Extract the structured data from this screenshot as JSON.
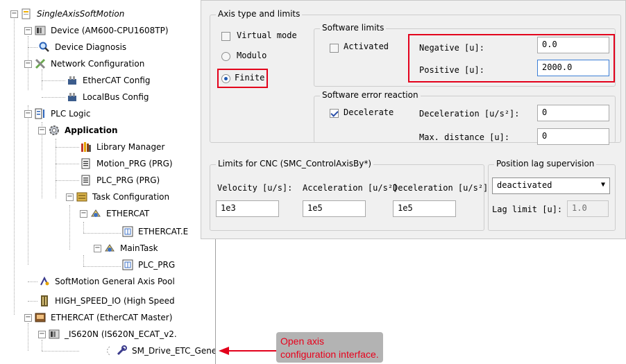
{
  "tree": {
    "root": "SingleAxisSoftMotion",
    "device": "Device (AM600-CPU1608TP)",
    "device_diagnosis": "Device Diagnosis",
    "network_configuration": "Network Configuration",
    "ethercat_config": "EtherCAT Config",
    "localbus_config": "LocalBus Config",
    "plc_logic": "PLC Logic",
    "application": "Application",
    "library_manager": "Library Manager",
    "motion_prg": "Motion_PRG (PRG)",
    "plc_prg": "PLC_PRG (PRG)",
    "task_configuration": "Task Configuration",
    "ethercat_task": "ETHERCAT",
    "ethercat_e": "ETHERCAT.E",
    "main_task": "MainTask",
    "plc_prg_call": "PLC_PRG",
    "softmotion_pool": "SoftMotion General Axis Pool",
    "high_speed_io": "HIGH_SPEED_IO (High Speed",
    "ethercat_master": "ETHERCAT (EtherCAT Master)",
    "is620n": "_IS620N (IS620N_ECAT_v2.",
    "sm_drive": "SM_Drive_ETC_Generi"
  },
  "panel": {
    "axis_group_title": "Axis type and limits",
    "virtual_mode": "Virtual mode",
    "modulo": "Modulo",
    "finite": "Finite",
    "sw_limits_title": "Software limits",
    "activated": "Activated",
    "negative_label": "Negative [u]:",
    "negative_value": "0.0",
    "positive_label": "Positive [u]:",
    "positive_value": "2000.0",
    "sw_error_title": "Software error reaction",
    "decelerate": "Decelerate",
    "deceleration_label": "Deceleration [u/s²]:",
    "deceleration_value": "0",
    "max_distance_label": "Max. distance [u]:",
    "max_distance_value": "0",
    "cnc_title": "Limits for CNC (SMC_ControlAxisBy*)",
    "velocity_label": "Velocity [u/s]:",
    "velocity_value": "1e3",
    "acceleration_label": "Acceleration [u/s²]",
    "acceleration_value": "1e5",
    "cnc_deceleration_label": "Deceleration [u/s²]",
    "cnc_deceleration_value": "1e5",
    "lag_title": "Position lag supervision",
    "lag_select": "deactivated",
    "lag_limit_label": "Lag limit [u]:",
    "lag_limit_value": "1.0"
  },
  "annotation": {
    "line1": "Open axis",
    "line2": "configuration interface."
  },
  "colors": {
    "highlight": "#e3001b",
    "callout_bg": "#b3b3b3"
  }
}
